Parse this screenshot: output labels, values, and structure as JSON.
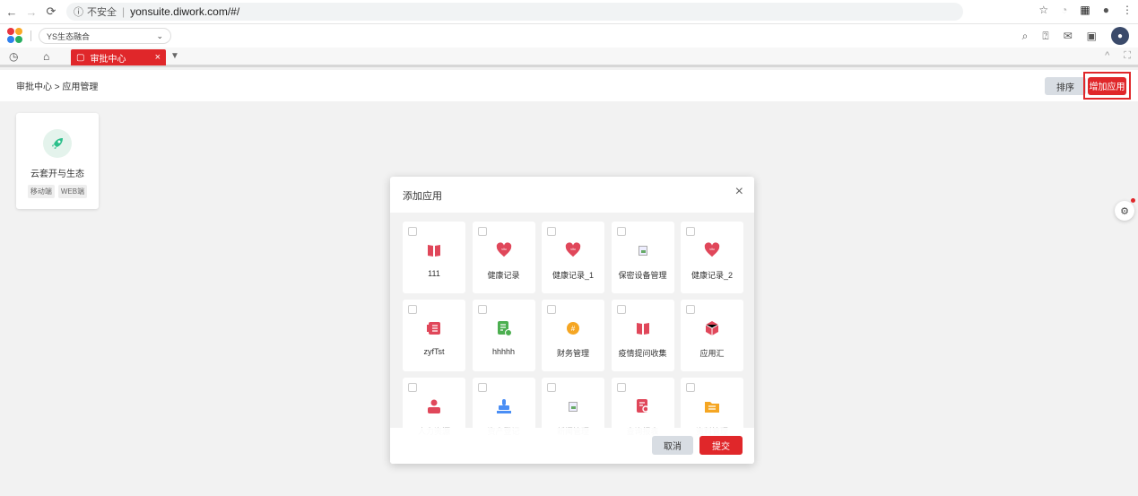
{
  "browser": {
    "insecure_label": "不安全",
    "url": "yonsuite.diwork.com/#/"
  },
  "app_header": {
    "tenant": "YS生态融合"
  },
  "tabs": [
    {
      "label": "审批中心",
      "active": true
    }
  ],
  "breadcrumb": "审批中心 > 应用管理",
  "toolbar": {
    "sort_label": "排序",
    "add_label": "增加应用"
  },
  "app_card": {
    "name": "云套开与生态",
    "tags": [
      "移动端",
      "WEB端"
    ],
    "icon": "rocket-icon"
  },
  "modal": {
    "title": "添加应用",
    "cancel_label": "取消",
    "submit_label": "提交",
    "tiles": [
      {
        "name": "111",
        "icon": "book-icon",
        "color": "#e0475a"
      },
      {
        "name": "健康记录",
        "icon": "heart-icon",
        "color": "#e0475a"
      },
      {
        "name": "健康记录_1",
        "icon": "heart-icon",
        "color": "#e0475a"
      },
      {
        "name": "保密设备管理",
        "icon": "broken-image-icon",
        "color": "#aaaaaa"
      },
      {
        "name": "健康记录_2",
        "icon": "heart-icon",
        "color": "#e0475a"
      },
      {
        "name": "zyfTst",
        "icon": "list-doc-icon",
        "color": "#e0475a"
      },
      {
        "name": "hhhhh",
        "icon": "doc-add-icon",
        "color": "#4caf50"
      },
      {
        "name": "财务管理",
        "icon": "coin-icon",
        "color": "#f5a623"
      },
      {
        "name": "疫情提问收集",
        "icon": "book-icon",
        "color": "#e0475a"
      },
      {
        "name": "应用汇",
        "icon": "cube-icon",
        "color": "#e0475a"
      },
      {
        "name": "人力资源",
        "icon": "person-icon",
        "color": "#e0475a"
      },
      {
        "name": "资产登记",
        "icon": "stamp-icon",
        "color": "#4a8ef5"
      },
      {
        "name": "新闻管理",
        "icon": "broken-image-icon",
        "color": "#aaaaaa"
      },
      {
        "name": "查询报表",
        "icon": "doc-search-icon",
        "color": "#e0475a"
      },
      {
        "name": "资料管理",
        "icon": "folder-icon",
        "color": "#f5a623"
      }
    ]
  }
}
